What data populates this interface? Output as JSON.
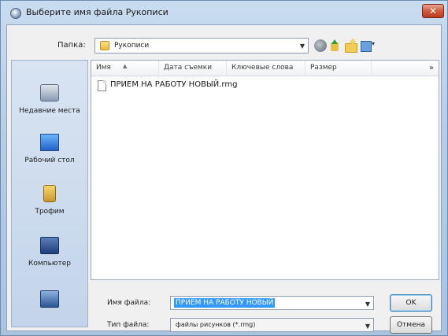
{
  "window": {
    "title": "Выберите имя файла Рукописи",
    "close_label": "✕"
  },
  "toolbar": {
    "folder_label": "Папка:",
    "folder_value": "Рукописи",
    "icons": [
      "back-icon",
      "up-folder-icon",
      "new-folder-icon",
      "views-menu-icon"
    ]
  },
  "places": [
    {
      "label": "Недавние места",
      "icon": "recent-places-icon"
    },
    {
      "label": "Рабочий стол",
      "icon": "desktop-icon"
    },
    {
      "label": "Трофим",
      "icon": "user-folder-icon"
    },
    {
      "label": "Компьютер",
      "icon": "computer-icon"
    },
    {
      "label": "",
      "icon": "network-icon"
    }
  ],
  "filelist": {
    "columns": [
      "Имя",
      "Дата съемки",
      "Ключевые слова",
      "Размер"
    ],
    "more": "»",
    "files": [
      {
        "name": "ПРИЕМ НА РАБОТУ НОВЫЙ.rmg",
        "icon": "document-icon"
      }
    ]
  },
  "bottom": {
    "filename_label": "Имя файла:",
    "filename_value": "ПРИЕМ НА РАБОТУ НОВЫЙ",
    "filetype_label": "Тип файла:",
    "filetype_value": "файлы рисунков (*.rmg)",
    "ok_label": "OK",
    "cancel_label": "Отмена"
  }
}
